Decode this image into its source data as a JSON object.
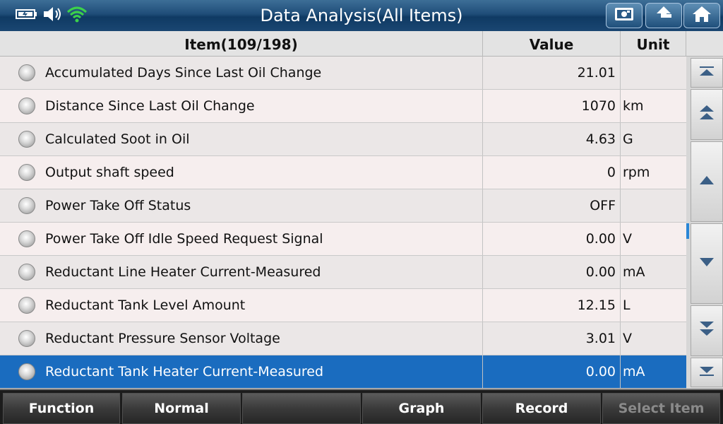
{
  "header": {
    "title": "Data Analysis(All Items)"
  },
  "table": {
    "columns": {
      "item": "Item(109/198)",
      "value": "Value",
      "unit": "Unit"
    },
    "rows": [
      {
        "label": "Accumulated Days Since Last Oil Change",
        "value": "21.01",
        "unit": ""
      },
      {
        "label": "Distance Since Last Oil Change",
        "value": "1070",
        "unit": "km"
      },
      {
        "label": "Calculated Soot in Oil",
        "value": "4.63",
        "unit": "G"
      },
      {
        "label": "Output shaft speed",
        "value": "0",
        "unit": "rpm"
      },
      {
        "label": "Power Take Off Status",
        "value": "OFF",
        "unit": ""
      },
      {
        "label": "Power Take Off Idle Speed Request Signal",
        "value": "0.00",
        "unit": "V"
      },
      {
        "label": "Reductant Line Heater Current-Measured",
        "value": "0.00",
        "unit": "mA"
      },
      {
        "label": "Reductant Tank Level Amount",
        "value": "12.15",
        "unit": "L"
      },
      {
        "label": "Reductant Pressure Sensor Voltage",
        "value": "3.01",
        "unit": "V"
      },
      {
        "label": "Reductant Tank Heater Current-Measured",
        "value": "0.00",
        "unit": "mA",
        "selected": true
      }
    ]
  },
  "footer": {
    "function_label": "Function",
    "normal_label": "Normal",
    "blank_label": "",
    "graph_label": "Graph",
    "record_label": "Record",
    "select_item_label": "Select Item"
  },
  "colors": {
    "header_blue": "#1f4d78",
    "selected_row": "#1a6cbf",
    "wifi_green": "#3cd24a"
  },
  "icons": [
    "battery-icon",
    "speaker-icon",
    "wifi-icon",
    "screenshot-icon",
    "back-icon",
    "home-icon"
  ]
}
